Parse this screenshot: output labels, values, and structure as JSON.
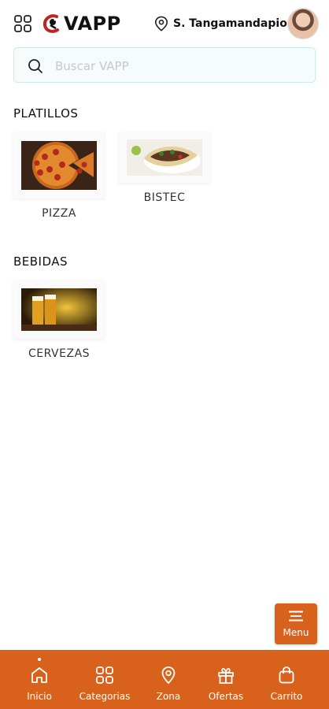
{
  "header": {
    "app_name": "VAPP",
    "location": "S. Tangamandapio"
  },
  "search": {
    "placeholder": "Buscar VAPP",
    "value": ""
  },
  "sections": [
    {
      "title": "PLATILLOS",
      "items": [
        {
          "label": "PIZZA"
        },
        {
          "label": "BISTEC"
        }
      ]
    },
    {
      "title": "BEBIDAS",
      "items": [
        {
          "label": "CERVEZAS"
        }
      ]
    }
  ],
  "menu_button": {
    "label": "Menu"
  },
  "bottom_nav": [
    {
      "label": "Inicio",
      "icon": "home-icon",
      "active": true
    },
    {
      "label": "Categorias",
      "icon": "grid-icon"
    },
    {
      "label": "Zona",
      "icon": "location-pin-icon"
    },
    {
      "label": "Ofertas",
      "icon": "gift-icon"
    },
    {
      "label": "Carrito",
      "icon": "shopping-bag-icon"
    }
  ],
  "colors": {
    "accent": "#d8621b",
    "search_border": "#cde9ea"
  }
}
